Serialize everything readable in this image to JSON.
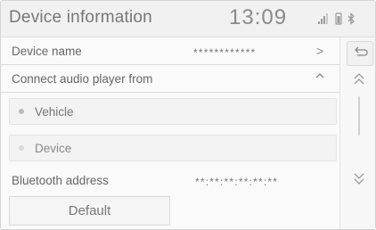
{
  "header": {
    "title": "Device information",
    "time": "13:09",
    "status_icons": [
      "signal-icon",
      "battery-icon",
      "bluetooth-icon"
    ]
  },
  "rows": {
    "device_name": {
      "label": "Device name",
      "value": "************"
    },
    "connect_from": {
      "label": "Connect audio player from"
    },
    "options": [
      {
        "label": "Vehicle"
      },
      {
        "label": "Device"
      }
    ],
    "bluetooth": {
      "label": "Bluetooth address",
      "value": "**:**:**:**:**:**"
    }
  },
  "buttons": {
    "default_label": "Default"
  },
  "icons": {
    "back": "back-icon",
    "scroll_up": "double-chevron-up-icon",
    "scroll_down": "double-chevron-down-icon",
    "next": "chevron-right-icon",
    "collapse": "chevron-up-icon"
  }
}
